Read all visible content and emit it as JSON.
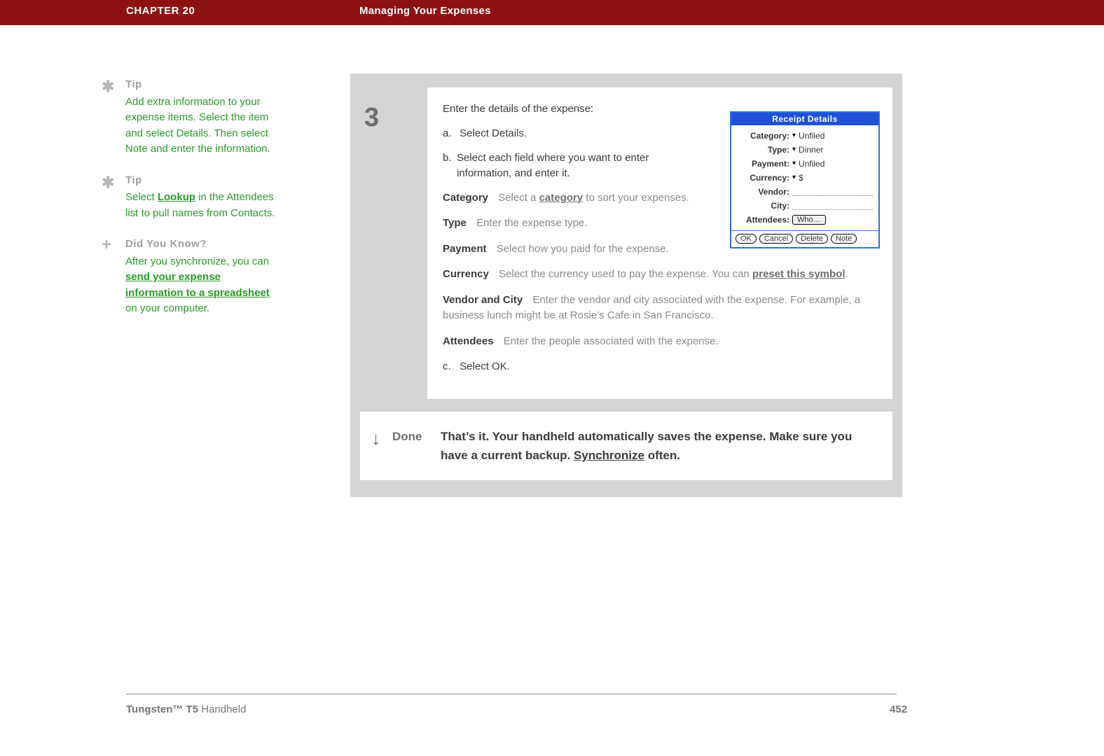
{
  "header": {
    "chapter": "CHAPTER 20",
    "title": "Managing Your Expenses"
  },
  "sidebar": {
    "tip1": {
      "heading": "Tip",
      "body": "Add extra information to your expense items. Select the item and select Details. Then select Note and enter the information."
    },
    "tip2": {
      "heading": "Tip",
      "body_before": "Select ",
      "link": "Lookup",
      "body_after": " in the Attendees list to pull names from Contacts."
    },
    "dyk": {
      "heading": "Did You Know?",
      "body_before": "After you synchronize, you can ",
      "link": "send your expense information to a spreadsheet",
      "body_after": " on your computer."
    }
  },
  "step": {
    "number": "3",
    "intro": "Enter the details of the expense:",
    "a": "Select Details.",
    "b": "Select each field where you want to enter information, and enter it.",
    "category": {
      "name": "Category",
      "before": "Select a ",
      "link": "category",
      "after": " to sort your expenses."
    },
    "type": {
      "name": "Type",
      "text": "Enter the expense type."
    },
    "payment": {
      "name": "Payment",
      "text": "Select how you paid for the expense."
    },
    "currency": {
      "name": "Currency",
      "before": "Select the currency used to pay the expense. You can ",
      "link": "preset this symbol",
      "after": "."
    },
    "vendorcity": {
      "name": "Vendor and City",
      "text": "Enter the vendor and city associated with the expense. For example, a business lunch might be at Rosie’s Cafe in San Francisco."
    },
    "attendees": {
      "name": "Attendees",
      "text": "Enter the people associated with the expense."
    },
    "c": "Select OK."
  },
  "dialog": {
    "title": "Receipt Details",
    "rows": {
      "category": {
        "label": "Category:",
        "value": "Unfiled"
      },
      "type": {
        "label": "Type:",
        "value": "Dinner"
      },
      "payment": {
        "label": "Payment:",
        "value": "Unfiled"
      },
      "currency": {
        "label": "Currency:",
        "value": "$"
      },
      "vendor": {
        "label": "Vendor:"
      },
      "city": {
        "label": "City:"
      },
      "attendees": {
        "label": "Attendees:",
        "button": "Who…"
      }
    },
    "buttons": {
      "ok": "OK",
      "cancel": "Cancel",
      "delete": "Delete",
      "note": "Note"
    }
  },
  "done": {
    "label": "Done",
    "text_before": "That’s it. Your handheld automatically saves the expense. Make sure you have a current backup. ",
    "link": "Synchronize",
    "text_after": " often."
  },
  "footer": {
    "product_bold": "Tungsten™ T5",
    "product_rest": " Handheld",
    "page": "452"
  }
}
